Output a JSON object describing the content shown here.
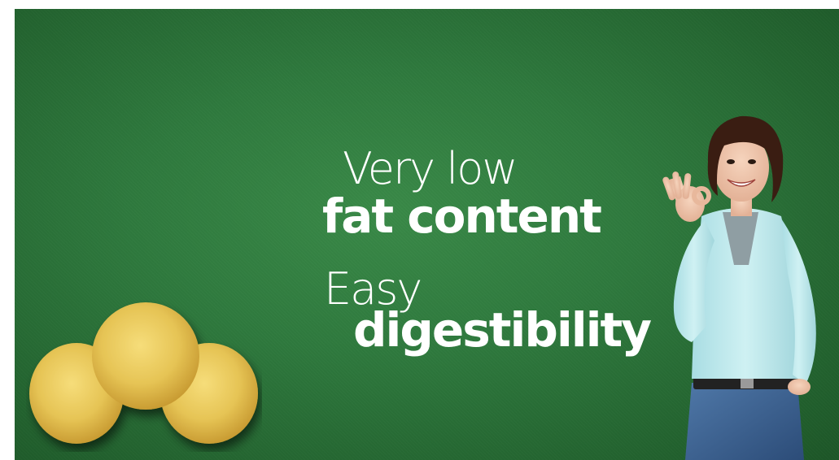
{
  "banner": {
    "line1_light": "Very low",
    "line1_bold": "fat content",
    "line2_light": "Easy",
    "line2_bold": "digestibility"
  },
  "colors": {
    "background": "#2f7a3e",
    "text": "#ffffff",
    "cookie": "#e8c95c",
    "shirt": "#c9eef0",
    "jeans": "#3a5f8f",
    "hair": "#3a1d12"
  },
  "images": {
    "cookies": "cookie-stack-photo",
    "woman": "smiling-woman-ok-gesture-photo"
  }
}
